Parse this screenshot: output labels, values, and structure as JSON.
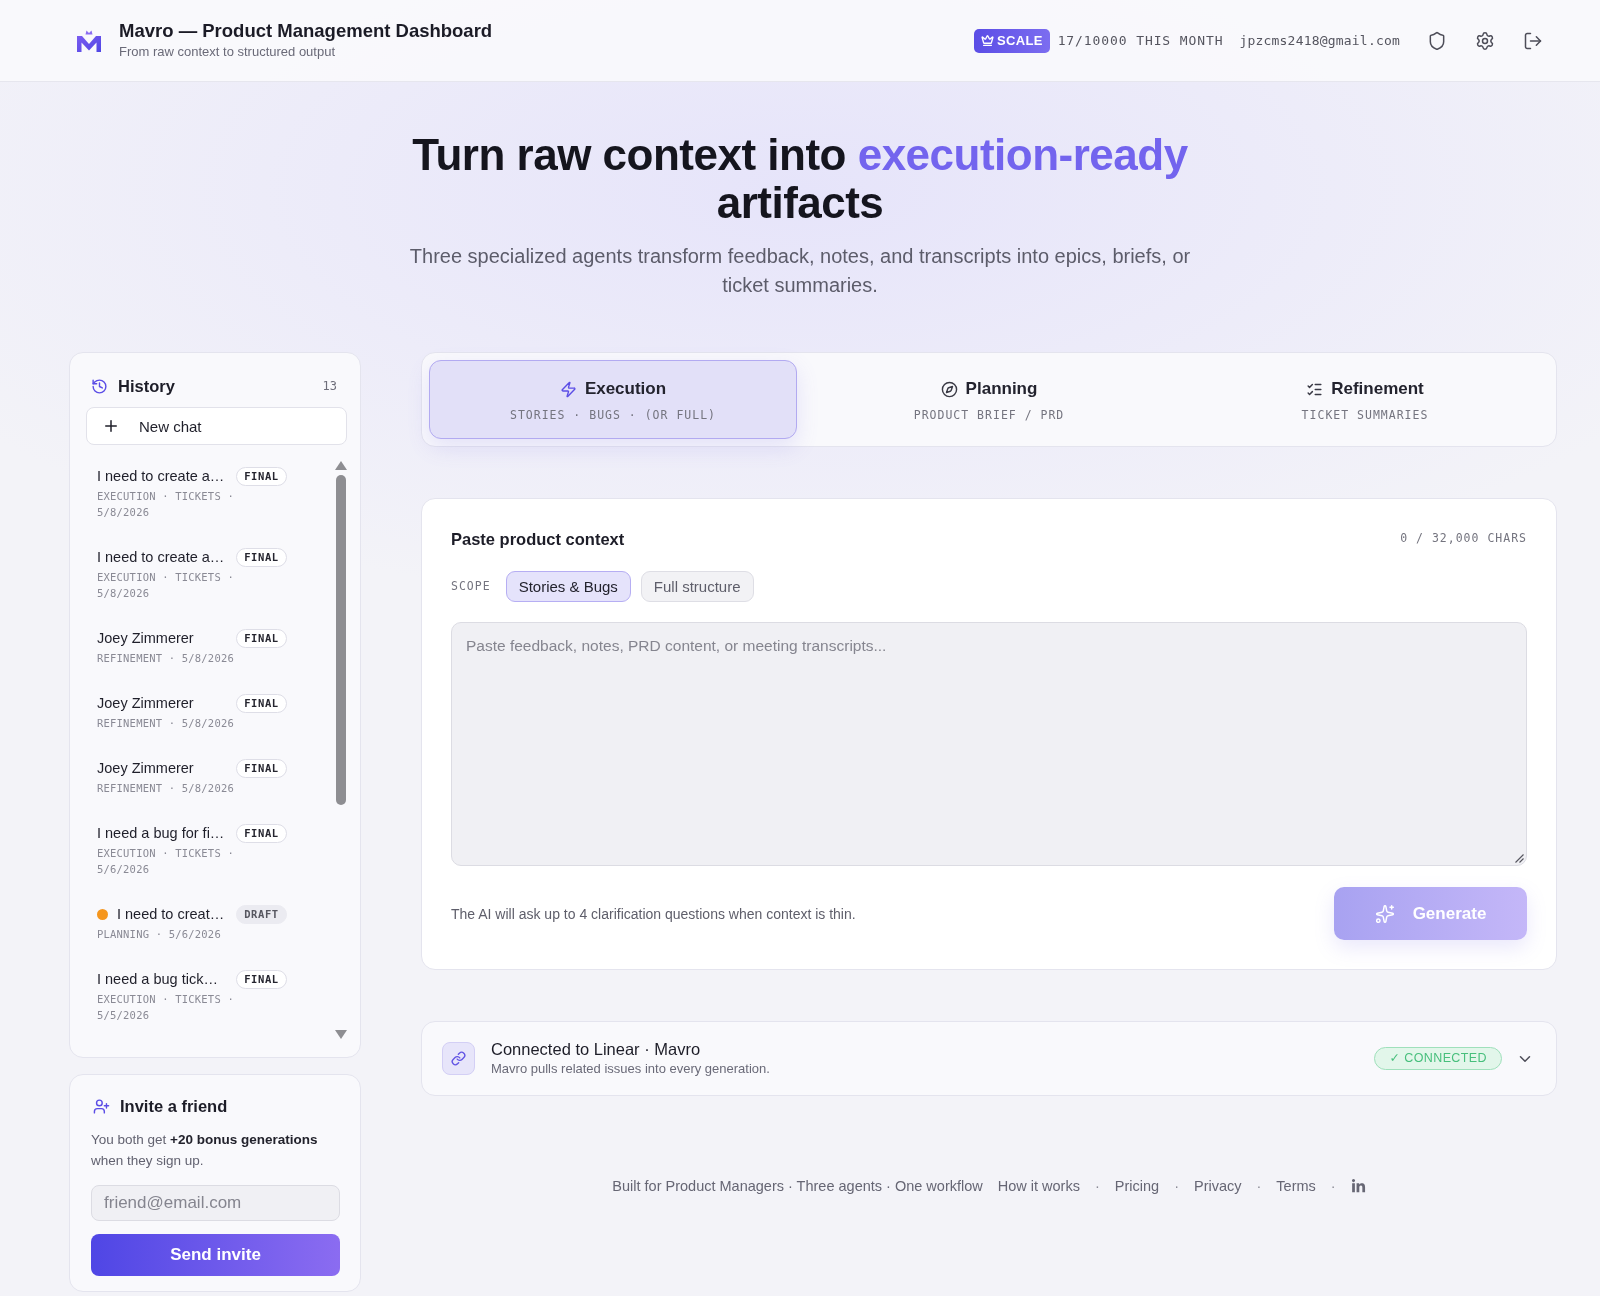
{
  "header": {
    "title": "Mavro — Product Management Dashboard",
    "subtitle": "From raw context to structured output",
    "plan": "SCALE",
    "usage": "17/10000 THIS MONTH",
    "email": "jpzcms2418@gmail.com"
  },
  "hero": {
    "title": "Turn raw context into **execution-ready** artifacts",
    "subtitle": "Three specialized agents transform feedback, notes, and transcripts into epics, briefs, or ticket summaries."
  },
  "history": {
    "title": "History",
    "count": "13",
    "new_chat": "New chat",
    "items": [
      {
        "title": "I need to create a…",
        "meta": "EXECUTION · TICKETS · 5/8/2026",
        "badge": "FINAL",
        "kind": "final",
        "selected": false
      },
      {
        "title": "I need to create a…",
        "meta": "EXECUTION · TICKETS · 5/8/2026",
        "badge": "FINAL",
        "kind": "final",
        "selected": false
      },
      {
        "title": "Joey Zimmerer",
        "meta": "REFINEMENT · 5/8/2026",
        "badge": "FINAL",
        "kind": "final",
        "selected": false
      },
      {
        "title": "Joey Zimmerer",
        "meta": "REFINEMENT · 5/8/2026",
        "badge": "FINAL",
        "kind": "final",
        "selected": false
      },
      {
        "title": "Joey Zimmerer",
        "meta": "REFINEMENT · 5/8/2026",
        "badge": "FINAL",
        "kind": "final",
        "selected": false
      },
      {
        "title": "I need a bug for fi…",
        "meta": "EXECUTION · TICKETS · 5/6/2026",
        "badge": "FINAL",
        "kind": "final",
        "selected": false
      },
      {
        "title": "I need to creat…",
        "meta": "PLANNING · 5/6/2026",
        "badge": "DRAFT",
        "kind": "draft",
        "selected": false
      },
      {
        "title": "I need a bug tick…",
        "meta": "EXECUTION · TICKETS · 5/5/2026",
        "badge": "FINAL",
        "kind": "final",
        "selected": false
      }
    ]
  },
  "invite": {
    "title": "Invite a friend",
    "text": "You both get **+20 bonus generations** when they sign up.",
    "placeholder": "friend@email.com",
    "button": "Send invite"
  },
  "tabs": [
    {
      "label": "Execution",
      "subtitle": "STORIES · BUGS · (OR FULL)",
      "selected": true
    },
    {
      "label": "Planning",
      "subtitle": "PRODUCT BRIEF / PRD",
      "selected": false
    },
    {
      "label": "Refinement",
      "subtitle": "TICKET SUMMARIES",
      "selected": false
    }
  ],
  "context": {
    "title": "Paste product context",
    "counter": "0 / 32,000 CHARS",
    "scope_label": "SCOPE",
    "scope_options": [
      {
        "label": "Stories & Bugs",
        "selected": true
      },
      {
        "label": "Full structure",
        "selected": false
      }
    ],
    "placeholder": "Paste feedback, notes, PRD content, or meeting transcripts...",
    "hint": "The AI will ask up to 4 clarification questions when context is thin.",
    "generate": {
      "label": "Generate",
      "disabled": true
    }
  },
  "integration": {
    "title": "Connected to Linear · Mavro",
    "description": "Mavro pulls related issues into every generation.",
    "status": "✓ CONNECTED",
    "connected": true,
    "expanded": false
  },
  "footer": {
    "tagline": "Built for Product Managers · Three agents · One workflow",
    "items": [
      {
        "kind": "link",
        "text": "How it works"
      },
      {
        "kind": "separator",
        "text": "·"
      },
      {
        "kind": "link",
        "text": "Pricing"
      },
      {
        "kind": "separator",
        "text": "·"
      },
      {
        "kind": "link",
        "text": "Privacy"
      },
      {
        "kind": "separator",
        "text": "·"
      },
      {
        "kind": "link",
        "text": "Terms"
      },
      {
        "kind": "separator",
        "text": "·"
      },
      {
        "kind": "icon_link"
      }
    ]
  }
}
